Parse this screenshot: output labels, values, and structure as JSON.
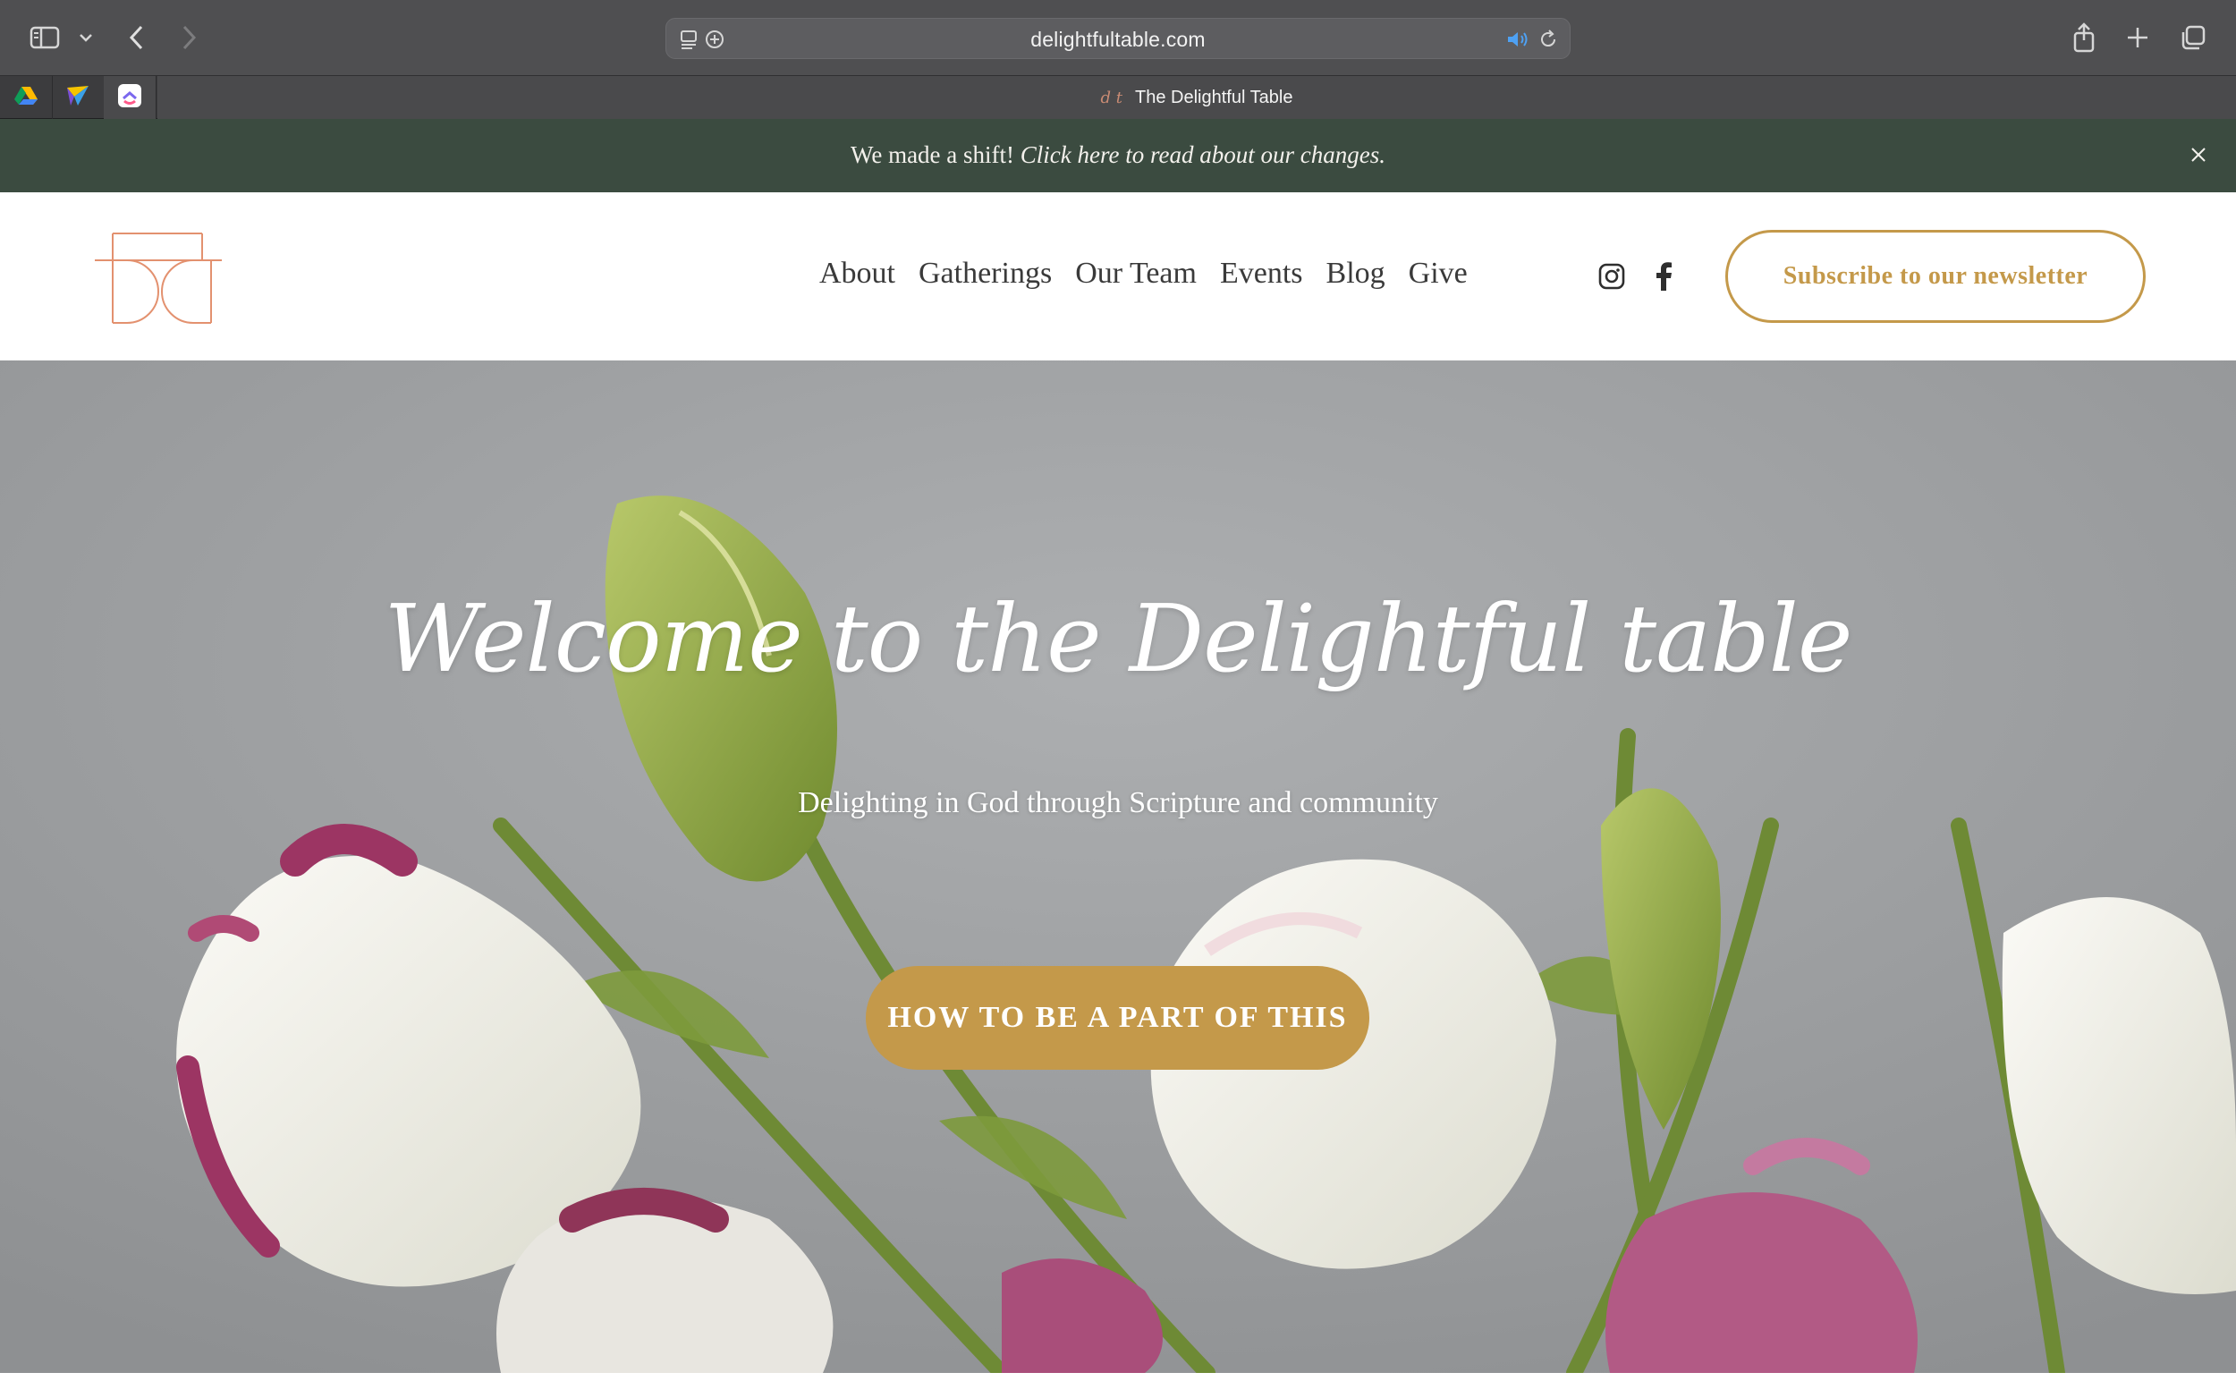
{
  "browser": {
    "url": "delightfultable.com",
    "tab_title": "The Delightful Table",
    "tab_favicon_text": "d t",
    "pinned_tabs": [
      "google-drive",
      "paper-plane-app",
      "clickup-app"
    ]
  },
  "announcement": {
    "prefix": "We made a shift! ",
    "link": "Click here to read about our changes."
  },
  "header": {
    "nav": [
      "About",
      "Gatherings",
      "Our Team",
      "Events",
      "Blog",
      "Give"
    ],
    "subscribe_label": "Subscribe to our newsletter"
  },
  "hero": {
    "title": "Welcome to the Delightful table",
    "subtitle": "Delighting in God through Scripture and community",
    "cta_label": "HOW TO BE A PART OF THIS"
  },
  "colors": {
    "announcement_bg": "#3b4b40",
    "accent_gold": "#c4994a",
    "logo_coral": "#e3916f",
    "nav_text": "#3a3a3a"
  }
}
